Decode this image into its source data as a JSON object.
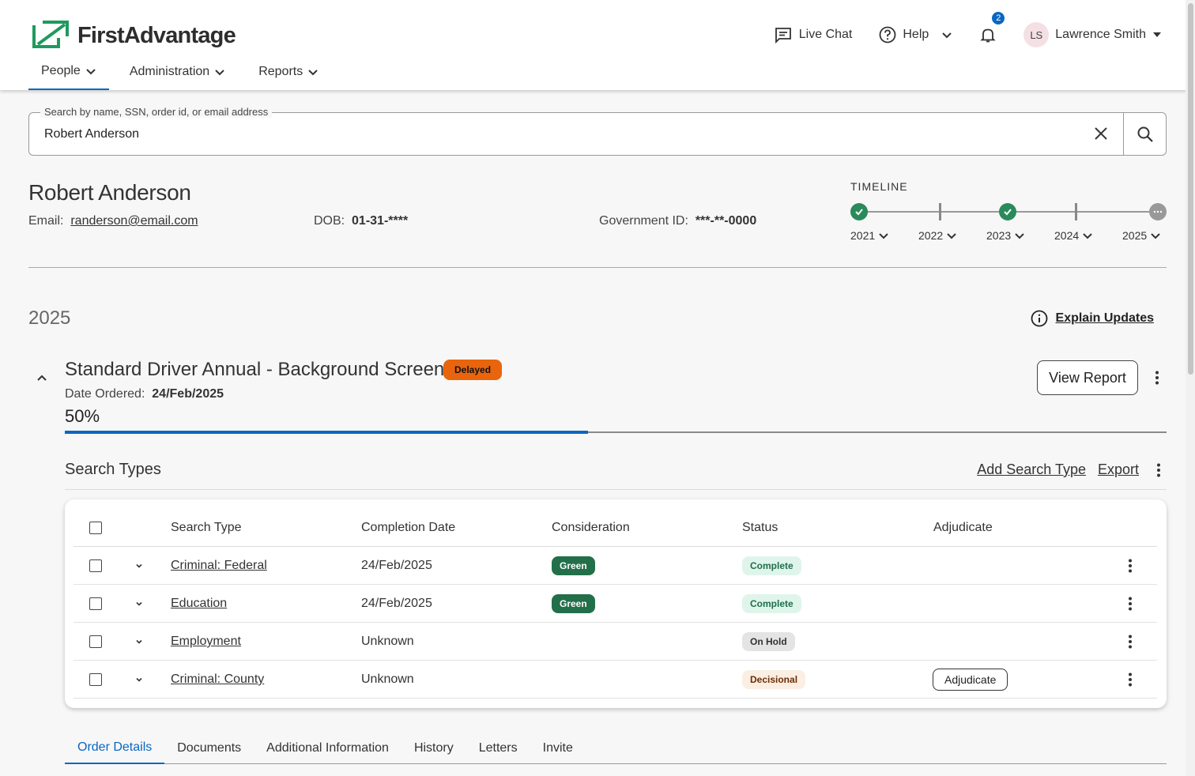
{
  "brand": {
    "logo_text": "FirstAdvantage",
    "accent": "#0a66c2",
    "green": "#2a8a5a"
  },
  "nav": {
    "items": [
      {
        "label": "People",
        "active": true
      },
      {
        "label": "Administration",
        "active": false
      },
      {
        "label": "Reports",
        "active": false
      }
    ]
  },
  "header": {
    "live_chat": "Live Chat",
    "help": "Help",
    "notification_count": "2",
    "user_initials": "LS",
    "user_name": "Lawrence Smith"
  },
  "search": {
    "label": "Search by name, SSN, order id, or email address",
    "value": "Robert Anderson"
  },
  "person": {
    "name": "Robert Anderson",
    "email_label": "Email:",
    "email": "randerson@email.com",
    "dob_label": "DOB:",
    "dob": "01-31-****",
    "gov_id_label": "Government ID:",
    "gov_id": "***-**-0000"
  },
  "timeline": {
    "title": "TIMELINE",
    "years": [
      {
        "label": "2021",
        "state": "done"
      },
      {
        "label": "2022",
        "state": "tick"
      },
      {
        "label": "2023",
        "state": "done"
      },
      {
        "label": "2024",
        "state": "tick"
      },
      {
        "label": "2025",
        "state": "pending"
      }
    ]
  },
  "section": {
    "year": "2025",
    "explain_updates": "Explain Updates"
  },
  "order": {
    "title": "Standard Driver Annual - Background Screen",
    "status_badge": "Delayed",
    "date_label": "Date Ordered:",
    "date": "24/Feb/2025",
    "progress_label": "50%",
    "progress": 0.5,
    "view_report": "View Report"
  },
  "search_types": {
    "heading": "Search Types",
    "add_label": "Add Search Type",
    "export_label": "Export",
    "columns": {
      "search_type": "Search Type",
      "completion_date": "Completion Date",
      "consideration": "Consideration",
      "status": "Status",
      "adjudicate": "Adjudicate"
    },
    "rows": [
      {
        "search_type": "Criminal: Federal",
        "completion_date": "24/Feb/2025",
        "consideration": "Green",
        "status": "Complete",
        "adjudicate": ""
      },
      {
        "search_type": "Education",
        "completion_date": "24/Feb/2025",
        "consideration": "Green",
        "status": "Complete",
        "adjudicate": ""
      },
      {
        "search_type": "Employment",
        "completion_date": "Unknown",
        "consideration": "",
        "status": "On Hold",
        "adjudicate": ""
      },
      {
        "search_type": "Criminal: County",
        "completion_date": "Unknown",
        "consideration": "",
        "status": "Decisional",
        "adjudicate": "Adjudicate"
      }
    ]
  },
  "tabs": [
    {
      "label": "Order Details",
      "active": true
    },
    {
      "label": "Documents",
      "active": false
    },
    {
      "label": "Additional Information",
      "active": false
    },
    {
      "label": "History",
      "active": false
    },
    {
      "label": "Letters",
      "active": false
    },
    {
      "label": "Invite",
      "active": false
    }
  ]
}
